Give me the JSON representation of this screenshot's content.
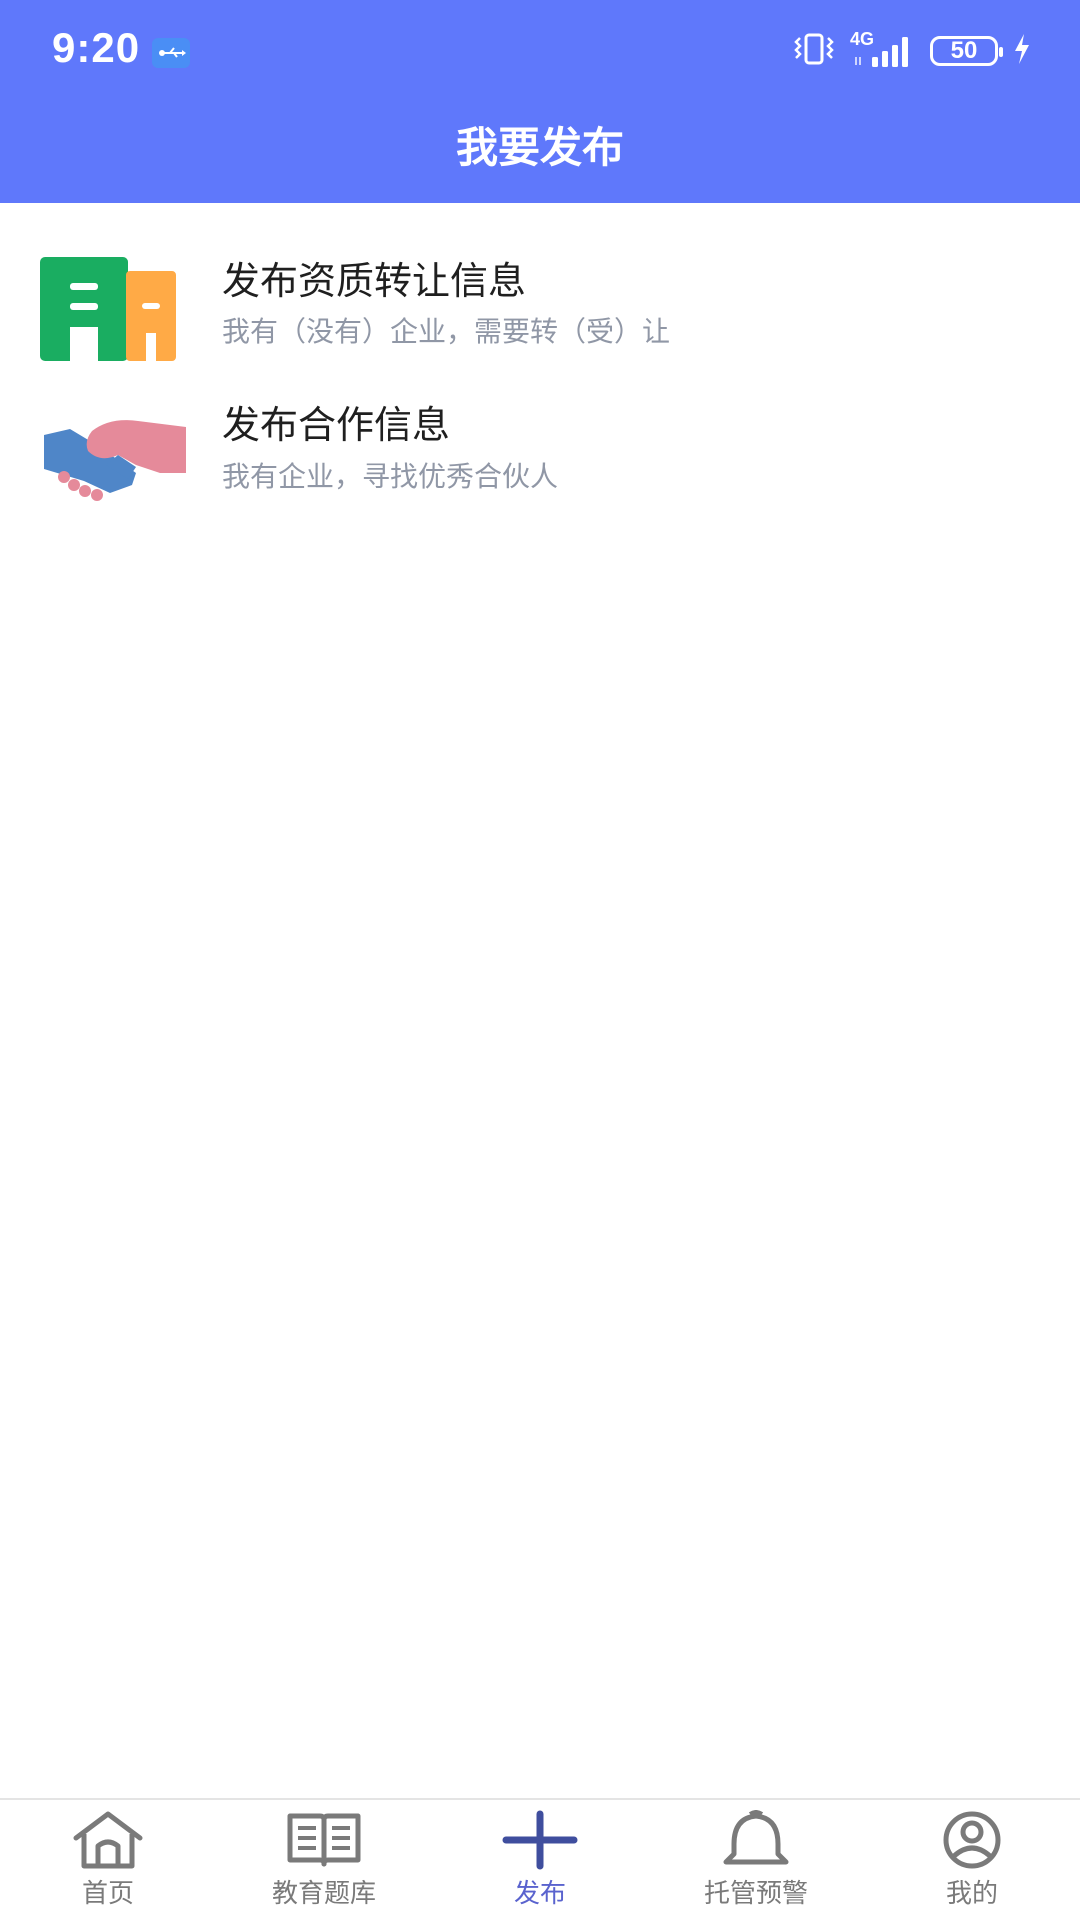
{
  "status_bar": {
    "time": "9:20",
    "network": "4G",
    "battery": "50"
  },
  "header": {
    "title": "我要发布"
  },
  "menu": [
    {
      "title": "发布资质转让信息",
      "subtitle": "我有（没有）企业，需要转（受）让",
      "icon": "building-icon"
    },
    {
      "title": "发布合作信息",
      "subtitle": "我有企业，寻找优秀合伙人",
      "icon": "handshake-icon"
    }
  ],
  "bottom_nav": [
    {
      "label": "首页",
      "icon": "home-icon",
      "active": false
    },
    {
      "label": "教育题库",
      "icon": "book-icon",
      "active": false
    },
    {
      "label": "发布",
      "icon": "plus-icon",
      "active": true
    },
    {
      "label": "托管预警",
      "icon": "bell-icon",
      "active": false
    },
    {
      "label": "我的",
      "icon": "user-icon",
      "active": false
    }
  ],
  "colors": {
    "header_bg": "#5f78fb",
    "active_tab": "#5a63ce",
    "inactive_tab": "#7a7a7a",
    "title_text": "#1f1f1f",
    "subtitle_text": "#9097a6",
    "building_green": "#1aad61",
    "building_orange": "#ffaa46",
    "hand_blue": "#4f86c8",
    "hand_pink": "#e58a9a"
  }
}
